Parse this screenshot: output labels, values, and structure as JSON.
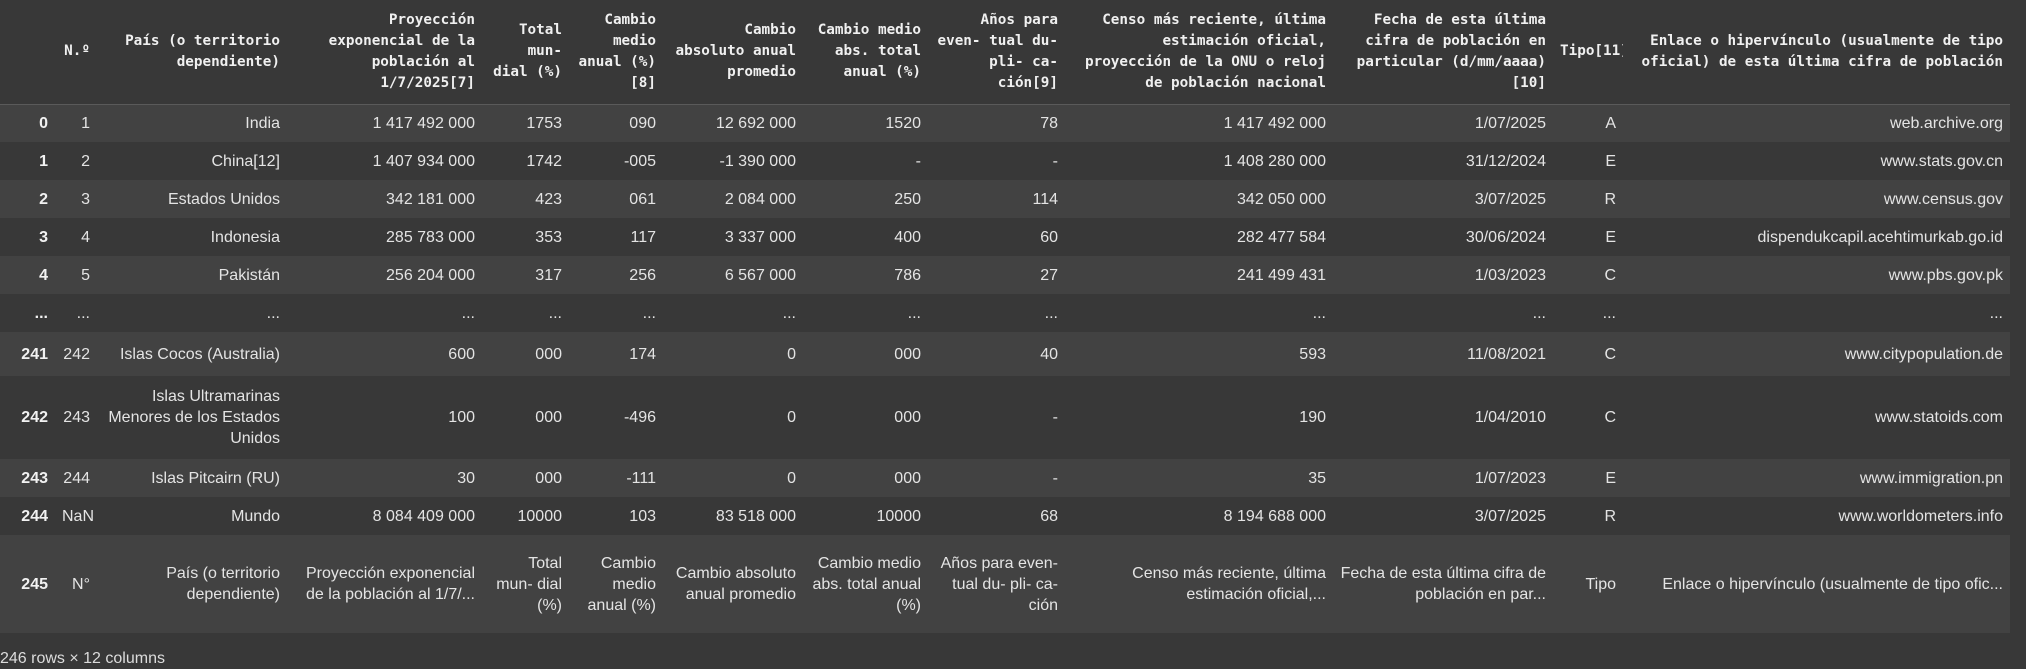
{
  "columns": [
    "",
    "N.º",
    "País (o territorio dependiente)",
    "Proyección exponencial de la población al 1/7/2025[7]",
    "Total mun- dial (%)",
    "Cambio medio anual (%) [8]",
    "Cambio absoluto anual promedio",
    "Cambio medio abs. total anual (%)",
    "Años para even- tual du- pli- ca- ción[9]",
    "Censo más reciente, última estimación oficial, proyección de la ONU o reloj de población nacional",
    "Fecha de esta última cifra de población en particular (d/mm/aaaa)[10]",
    "Tipo[11]",
    "Enlace o hipervínculo (usualmente de tipo oficial) de esta última cifra de población"
  ],
  "rows": [
    [
      "0",
      "1",
      "India",
      "1 417 492 000",
      "1753",
      "090",
      "12 692 000",
      "1520",
      "78",
      "1 417 492 000",
      "1/07/2025",
      "A",
      "web.archive.org"
    ],
    [
      "1",
      "2",
      "China[12]",
      "1 407 934 000",
      "1742",
      "-005",
      "-1 390 000",
      "-",
      "-",
      "1 408 280 000",
      "31/12/2024",
      "E",
      "www.stats.gov.cn"
    ],
    [
      "2",
      "3",
      "Estados Unidos",
      "342 181 000",
      "423",
      "061",
      "2 084 000",
      "250",
      "114",
      "342 050 000",
      "3/07/2025",
      "R",
      "www.census.gov"
    ],
    [
      "3",
      "4",
      "Indonesia",
      "285 783 000",
      "353",
      "117",
      "3 337 000",
      "400",
      "60",
      "282 477 584",
      "30/06/2024",
      "E",
      "dispendukcapil.acehtimurkab.go.id"
    ],
    [
      "4",
      "5",
      "Pakistán",
      "256 204 000",
      "317",
      "256",
      "6 567 000",
      "786",
      "27",
      "241 499 431",
      "1/03/2023",
      "C",
      "www.pbs.gov.pk"
    ],
    [
      "...",
      "...",
      "...",
      "...",
      "...",
      "...",
      "...",
      "...",
      "...",
      "...",
      "...",
      "...",
      "..."
    ],
    [
      "241",
      "242",
      "Islas Cocos (Australia)",
      "600",
      "000",
      "174",
      "0",
      "000",
      "40",
      "593",
      "11/08/2021",
      "C",
      "www.citypopulation.de"
    ],
    [
      "242",
      "243",
      "Islas Ultramarinas Menores de los Estados Unidos",
      "100",
      "000",
      "-496",
      "0",
      "000",
      "-",
      "190",
      "1/04/2010",
      "C",
      "www.statoids.com"
    ],
    [
      "243",
      "244",
      "Islas Pitcairn (RU)",
      "30",
      "000",
      "-111",
      "0",
      "000",
      "-",
      "35",
      "1/07/2023",
      "E",
      "www.immigration.pn"
    ],
    [
      "244",
      "NaN",
      "Mundo",
      "8 084 409 000",
      "10000",
      "103",
      "83 518 000",
      "10000",
      "68",
      "8 194 688 000",
      "3/07/2025",
      "R",
      "www.worldometers.info"
    ],
    [
      "245",
      "N°",
      "País (o territorio dependiente)",
      "Proyección exponencial de la población al 1/7/...",
      "Total mun- dial (%)",
      "Cambio medio anual (%)",
      "Cambio absoluto anual promedio",
      "Cambio medio abs. total anual (%)",
      "Años para even- tual du- pli- ca- ción",
      "Censo más reciente, última estimación oficial,...",
      "Fecha de esta última cifra de población en par...",
      "Tipo",
      "Enlace o hipervínculo (usualmente de tipo ofic..."
    ]
  ],
  "footer": "246 rows × 12 columns"
}
